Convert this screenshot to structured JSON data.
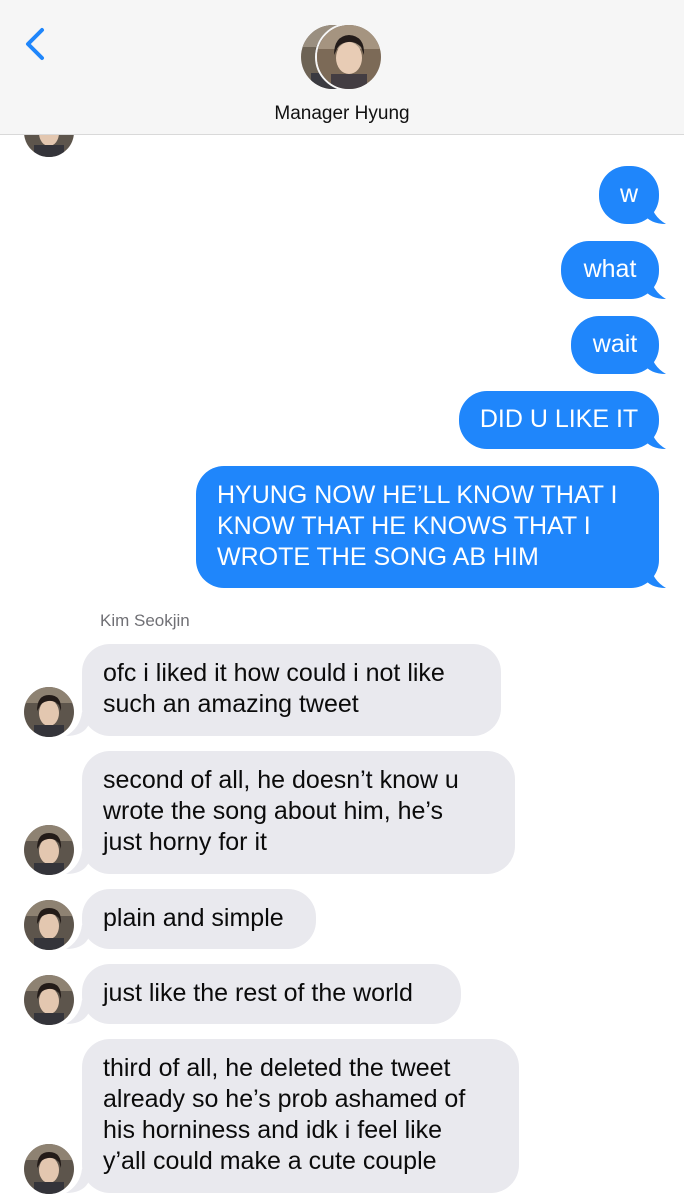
{
  "header": {
    "title": "Manager Hyung",
    "back_icon": "chevron-left-icon",
    "accent": "#1f86fb"
  },
  "messages": {
    "outgoing": [
      {
        "text": "w"
      },
      {
        "text": "what"
      },
      {
        "text": "wait"
      },
      {
        "text": "DID U LIKE IT"
      },
      {
        "text": "HYUNG NOW HE’LL KNOW THAT I\nKNOW THAT HE KNOWS THAT I\nWROTE THE SONG AB HIM"
      }
    ],
    "sender_name": "Kim Seokjin",
    "incoming": [
      {
        "text": "ofc i liked it how could i not like\nsuch an amazing tweet"
      },
      {
        "text": "second of all, he doesn’t know u\nwrote the song about him, he’s\njust horny for it"
      },
      {
        "text": "plain and simple"
      },
      {
        "text": "just like the rest of the world"
      },
      {
        "text": "third of all, he deleted the tweet\nalready so he’s prob ashamed of\nhis horniness and idk i feel like\ny’all could make a cute couple"
      }
    ]
  },
  "colors": {
    "outgoing_bubble": "#1f86fb",
    "incoming_bubble": "#e9e9ee",
    "header_bg": "#f6f6f6"
  }
}
